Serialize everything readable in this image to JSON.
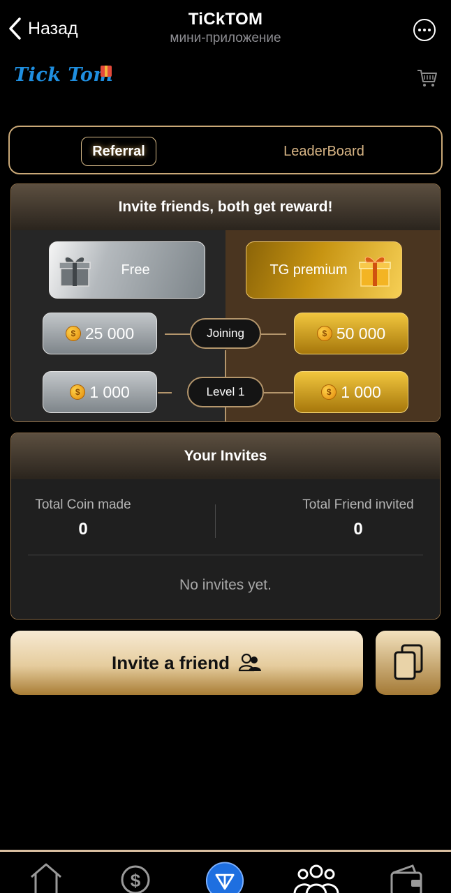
{
  "topbar": {
    "back_label": "Назад",
    "title": "TiCkTOM",
    "subtitle": "мини-приложение",
    "more_icon": "more-horizontal-icon"
  },
  "brand": {
    "logo_text": "Tick Tom",
    "cart_icon": "cart-icon"
  },
  "tabs": [
    {
      "label": "Referral",
      "active": true
    },
    {
      "label": "LeaderBoard",
      "active": false
    }
  ],
  "reward_panel": {
    "heading": "Invite friends, both get reward!",
    "tiers": {
      "free_label": "Free",
      "premium_label": "TG premium"
    },
    "rows": [
      {
        "label": "Joining",
        "free_value": "25 000",
        "premium_value": "50 000"
      },
      {
        "label": "Level 1",
        "free_value": "1 000",
        "premium_value": "1 000"
      }
    ]
  },
  "invites_panel": {
    "heading": "Your Invites",
    "coins_label": "Total Coin made",
    "coins_value": "0",
    "friends_label": "Total Friend invited",
    "friends_value": "0",
    "empty_text": "No invites yet."
  },
  "actions": {
    "invite_label": "Invite a friend",
    "copy_icon": "copy-icon"
  },
  "nav": [
    "home-icon",
    "dollar-icon",
    "ton-icon",
    "friends-icon",
    "wallet-icon"
  ],
  "colors": {
    "accent_gold": "#c9a877",
    "silver": "#9aa0a4",
    "gold": "#e2b02a",
    "ton_blue": "#1e6fe0"
  }
}
